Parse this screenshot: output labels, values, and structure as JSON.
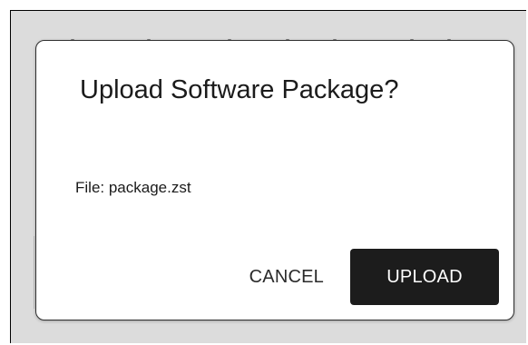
{
  "dialog": {
    "title": "Upload Software Package?",
    "file_label": "File: package.zst",
    "cancel_label": "CANCEL",
    "upload_label": "UPLOAD"
  },
  "colors": {
    "overlay": "#dcdcdc",
    "dialog_background": "#ffffff",
    "primary_button": "#1c1c1c",
    "primary_button_text": "#ffffff",
    "text": "#1b1b1b"
  }
}
